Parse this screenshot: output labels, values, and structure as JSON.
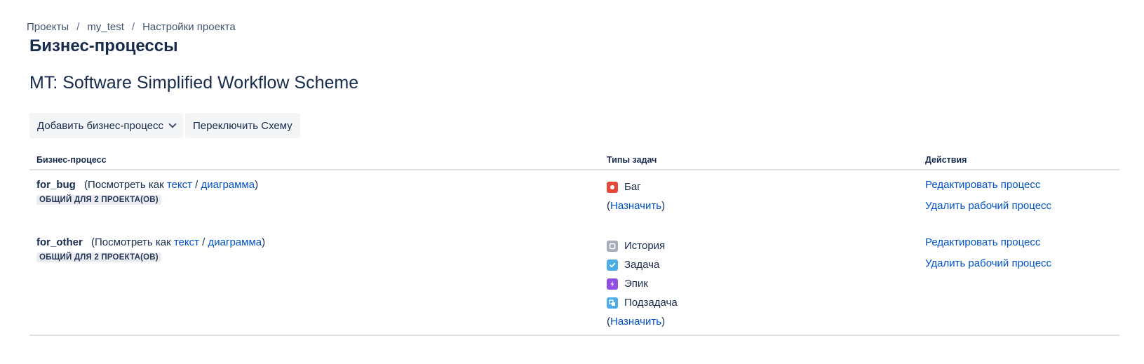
{
  "breadcrumb": {
    "items": [
      "Проекты",
      "my_test",
      "Настройки проекта"
    ],
    "sep": "/"
  },
  "page_title": "Бизнес-процессы",
  "scheme_title": "MT: Software Simplified Workflow Scheme",
  "toolbar": {
    "add_label": "Добавить бизнес-процесс",
    "switch_label": "Переключить Схему"
  },
  "table": {
    "headers": {
      "workflow": "Бизнес-процесс",
      "issue_types": "Типы задач",
      "actions": "Действия"
    },
    "rows": [
      {
        "name": "for_bug",
        "view_prefix": "(Посмотреть как",
        "view_text": "текст",
        "view_sep": "/",
        "view_diagram": "диаграмма",
        "view_suffix": ")",
        "shared": "ОБЩИЙ ДЛЯ 2 ПРОЕКТА(ОВ)",
        "issue_types": [
          {
            "label": "Баг",
            "icon": "bug-icon",
            "color": "#e5493a"
          }
        ],
        "assign_open": "(",
        "assign_label": "Назначить",
        "assign_close": ")",
        "actions": {
          "edit": "Редактировать процесс",
          "delete": "Удалить рабочий процесс"
        }
      },
      {
        "name": "for_other",
        "view_prefix": "(Посмотреть как",
        "view_text": "текст",
        "view_sep": "/",
        "view_diagram": "диаграмма",
        "view_suffix": ")",
        "shared": "ОБЩИЙ ДЛЯ 2 ПРОЕКТА(ОВ)",
        "issue_types": [
          {
            "label": "История",
            "icon": "story-icon",
            "color": "#a5adba"
          },
          {
            "label": "Задача",
            "icon": "task-icon",
            "color": "#4bade8"
          },
          {
            "label": "Эпик",
            "icon": "epic-icon",
            "color": "#904ee2"
          },
          {
            "label": "Подзадача",
            "icon": "subtask-icon",
            "color": "#4bade8"
          }
        ],
        "assign_open": "(",
        "assign_label": "Назначить",
        "assign_close": ")",
        "actions": {
          "edit": "Редактировать процесс",
          "delete": "Удалить рабочий процесс"
        }
      }
    ]
  }
}
